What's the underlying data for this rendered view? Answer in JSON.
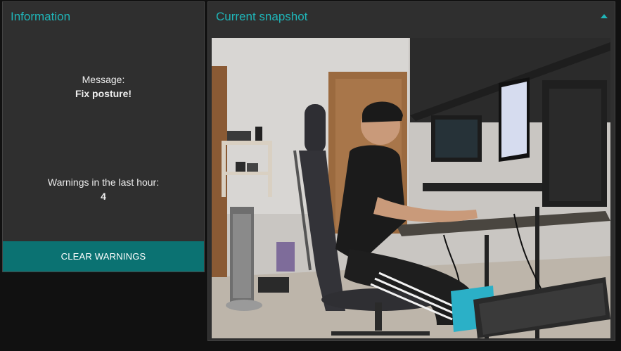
{
  "info": {
    "title": "Information",
    "message_label": "Message:",
    "message_value": "Fix posture!",
    "warnings_label": "Warnings in the last hour:",
    "warnings_value": "4",
    "clear_button": "CLEAR WARNINGS"
  },
  "snapshot": {
    "title": "Current snapshot",
    "collapse_icon": "chevron-up-icon"
  },
  "colors": {
    "accent": "#1fb5b8",
    "button": "#0b7272",
    "panel_bg": "#2f2f2f",
    "page_bg": "#111111"
  }
}
